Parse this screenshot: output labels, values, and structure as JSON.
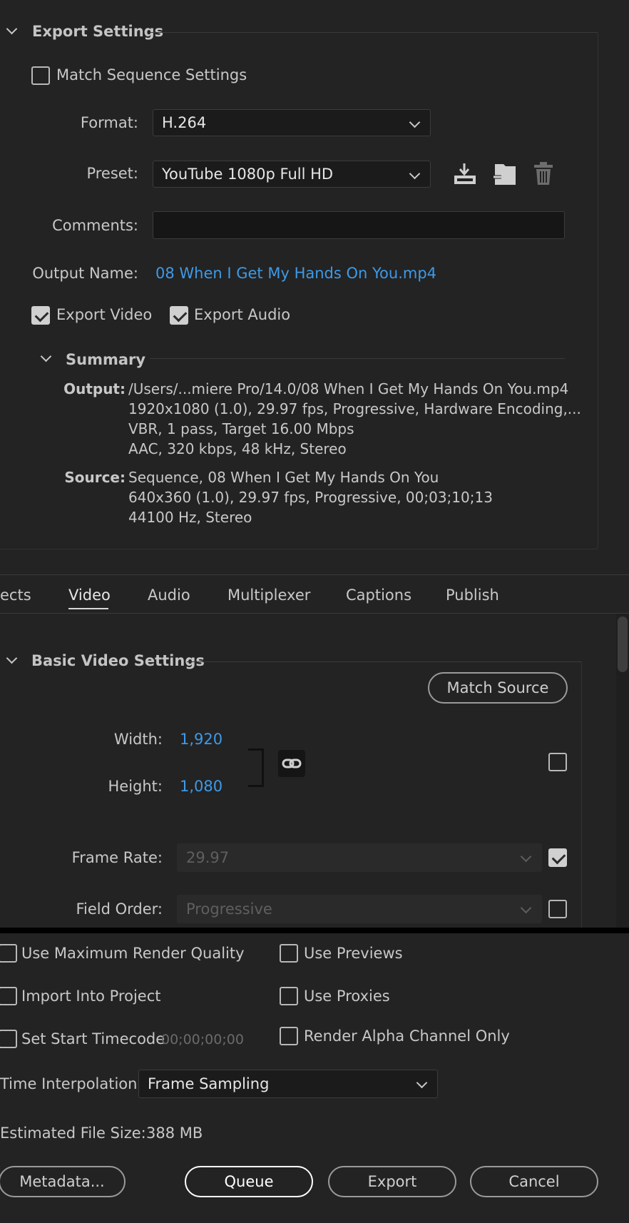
{
  "export_settings": {
    "title": "Export Settings",
    "match_sequence_label": "Match Sequence Settings",
    "match_sequence_checked": false,
    "format_label": "Format:",
    "format_value": "H.264",
    "preset_label": "Preset:",
    "preset_value": "YouTube 1080p Full HD",
    "comments_label": "Comments:",
    "comments_value": "",
    "output_name_label": "Output Name:",
    "output_name_value": "08 When I Get My Hands On You.mp4",
    "export_video_label": "Export Video",
    "export_video_checked": true,
    "export_audio_label": "Export Audio",
    "export_audio_checked": true
  },
  "summary": {
    "title": "Summary",
    "output_label": "Output:",
    "output_lines": [
      "/Users/...miere Pro/14.0/08 When I Get My Hands On You.mp4",
      "1920x1080 (1.0), 29.97 fps, Progressive, Hardware Encoding,...",
      "VBR, 1 pass, Target 16.00 Mbps",
      "AAC, 320 kbps, 48 kHz, Stereo"
    ],
    "source_label": "Source:",
    "source_lines": [
      "Sequence, 08 When I Get My Hands On You",
      "640x360 (1.0), 29.97 fps, Progressive, 00;03;10;13",
      "44100 Hz, Stereo"
    ]
  },
  "tabs": [
    "ects",
    "Video",
    "Audio",
    "Multiplexer",
    "Captions",
    "Publish"
  ],
  "active_tab": "Video",
  "basic_video": {
    "title": "Basic Video Settings",
    "match_source_label": "Match Source",
    "width_label": "Width:",
    "width_value": "1,920",
    "height_label": "Height:",
    "height_value": "1,080",
    "frame_rate_label": "Frame Rate:",
    "frame_rate_value": "29.97",
    "frame_rate_checked": true,
    "field_order_label": "Field Order:",
    "field_order_value": "Progressive",
    "field_order_checked": false,
    "size_checked": false
  },
  "options": {
    "max_render_label": "Use Maximum Render Quality",
    "use_previews_label": "Use Previews",
    "import_project_label": "Import Into Project",
    "use_proxies_label": "Use Proxies",
    "start_timecode_label": "Set Start Timecode",
    "start_timecode_value": "00;00;00;00",
    "render_alpha_label": "Render Alpha Channel Only",
    "time_interp_label": "Time Interpolation:",
    "time_interp_value": "Frame Sampling",
    "file_size_label": "Estimated File Size:",
    "file_size_value": "388 MB"
  },
  "buttons": {
    "metadata": "Metadata...",
    "queue": "Queue",
    "export": "Export",
    "cancel": "Cancel"
  },
  "icons": {
    "save_preset": "save-preset-icon",
    "import_preset": "import-preset-icon",
    "delete_preset": "trash-icon",
    "link": "link-icon"
  }
}
